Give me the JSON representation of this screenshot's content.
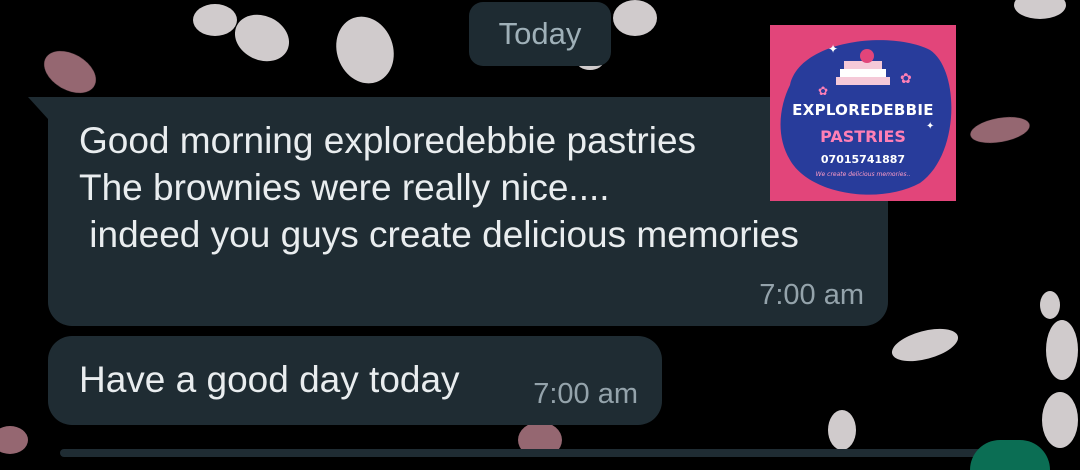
{
  "date_chip": "Today",
  "messages": [
    {
      "lines": [
        "Good morning exploredebbie pastries",
        "The brownies were really nice....",
        " indeed you guys create delicious memories"
      ],
      "time": "7:00 am"
    },
    {
      "lines": [
        "Have a good day today"
      ],
      "time": "7:00 am"
    }
  ],
  "logo": {
    "brand": "EXPLOREDEBBIE",
    "sub": "PASTRIES",
    "phone": "07015741887",
    "tagline": "We create delicious memories.."
  },
  "colors": {
    "background": "#000000",
    "bubble": "#1f2c33",
    "text": "#e9edef",
    "time": "#94a3ab",
    "logo_bg": "#e2457a",
    "logo_circle": "#283c9b"
  }
}
